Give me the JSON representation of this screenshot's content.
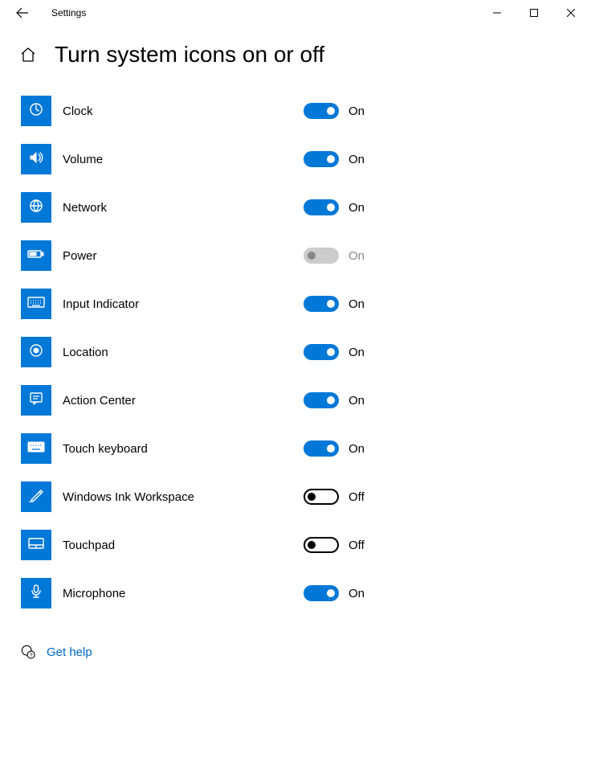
{
  "app_title": "Settings",
  "page_title": "Turn system icons on or off",
  "toggle_on_label": "On",
  "toggle_off_label": "Off",
  "rows": [
    {
      "icon": "clock",
      "label": "Clock",
      "state": "on",
      "enabled": true
    },
    {
      "icon": "volume",
      "label": "Volume",
      "state": "on",
      "enabled": true
    },
    {
      "icon": "network",
      "label": "Network",
      "state": "on",
      "enabled": true
    },
    {
      "icon": "power",
      "label": "Power",
      "state": "on-disabled",
      "enabled": false
    },
    {
      "icon": "keyboard",
      "label": "Input Indicator",
      "state": "on",
      "enabled": true
    },
    {
      "icon": "location",
      "label": "Location",
      "state": "on",
      "enabled": true
    },
    {
      "icon": "action",
      "label": "Action Center",
      "state": "on",
      "enabled": true
    },
    {
      "icon": "touchkb",
      "label": "Touch keyboard",
      "state": "on",
      "enabled": true
    },
    {
      "icon": "ink",
      "label": "Windows Ink Workspace",
      "state": "off",
      "enabled": true
    },
    {
      "icon": "touchpad",
      "label": "Touchpad",
      "state": "off",
      "enabled": true
    },
    {
      "icon": "mic",
      "label": "Microphone",
      "state": "on",
      "enabled": true
    }
  ],
  "help_link": "Get help"
}
